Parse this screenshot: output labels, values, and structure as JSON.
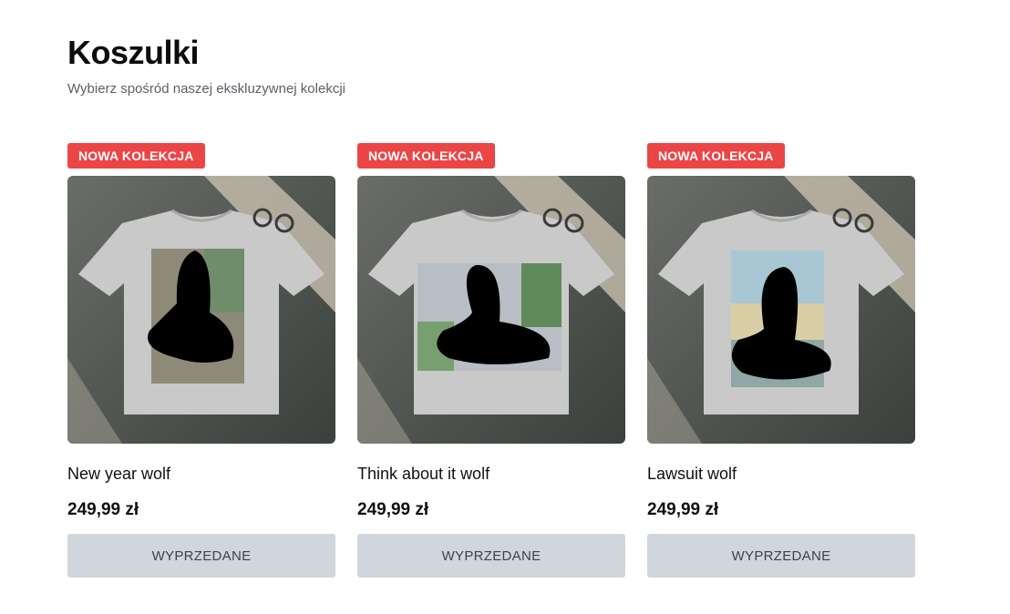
{
  "header": {
    "title": "Koszulki",
    "subtitle": "Wybierz spośród naszej ekskluzywnej kolekcji"
  },
  "products": [
    {
      "badge": "NOWA KOLEKCJA",
      "name": "New year wolf",
      "price": "249,99 zł",
      "button": "WYPRZEDANE"
    },
    {
      "badge": "NOWA KOLEKCJA",
      "name": "Think about it wolf",
      "price": "249,99 zł",
      "button": "WYPRZEDANE"
    },
    {
      "badge": "NOWA KOLEKCJA",
      "name": "Lawsuit wolf",
      "price": "249,99 zł",
      "button": "WYPRZEDANE"
    }
  ],
  "colors": {
    "badge": "#ec4545",
    "button_bg": "#d1d5dc",
    "button_text": "#3d4249"
  }
}
